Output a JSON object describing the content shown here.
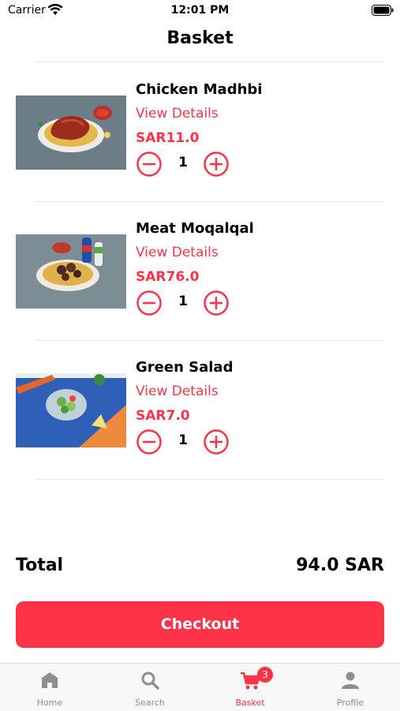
{
  "status_bar": {
    "carrier": "Carrier",
    "time": "12:01 PM"
  },
  "header": {
    "title": "Basket"
  },
  "items": [
    {
      "name": "Chicken Madhbi",
      "details_label": "View Details",
      "price": "SAR11.0",
      "quantity": "1",
      "image": "chicken-rice-photo"
    },
    {
      "name": "Meat Moqalqal",
      "details_label": "View Details",
      "price": "SAR76.0",
      "quantity": "1",
      "image": "meat-rice-photo"
    },
    {
      "name": "Green Salad",
      "details_label": "View Details",
      "price": "SAR7.0",
      "quantity": "1",
      "image": "salad-photo"
    }
  ],
  "summary": {
    "total_label": "Total",
    "total_value": "94.0 SAR"
  },
  "checkout": {
    "label": "Checkout"
  },
  "tab_bar": {
    "tabs": [
      {
        "label": "Home",
        "icon": "home-icon"
      },
      {
        "label": "Search",
        "icon": "search-icon"
      },
      {
        "label": "Basket",
        "icon": "cart-icon",
        "badge": "3",
        "active": true
      },
      {
        "label": "Profile",
        "icon": "person-icon"
      }
    ]
  },
  "colors": {
    "accent": "#ff3348",
    "tab_inactive": "#8e8e93",
    "divider": "#e8e8e8"
  }
}
